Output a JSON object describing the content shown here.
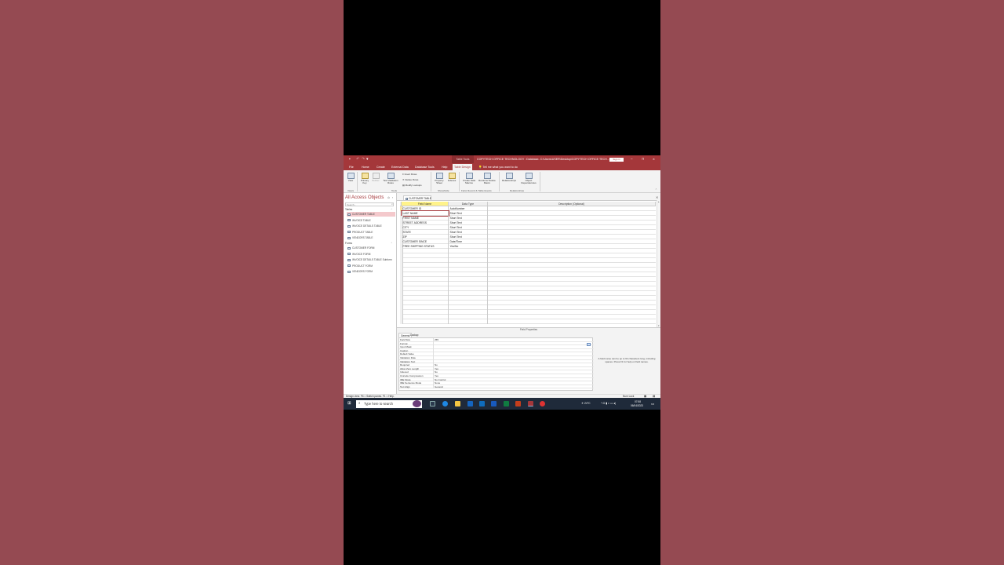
{
  "titlebar": {
    "contextual_tab": "Table Tools",
    "title": "COPYTECH OFFICE TECHNOLOGY : Database- C:\\Users\\USER\\Desktop\\COPYTECH OFFICE TECH...",
    "sign_in": "Sign in",
    "minimize": "–",
    "restore": "❐",
    "close": "✕"
  },
  "menu": {
    "items": [
      "File",
      "Home",
      "Create",
      "External Data",
      "Database Tools",
      "Help",
      "Table Design"
    ],
    "tell_me": "Tell me what you want to do"
  },
  "ribbon": {
    "view": "View",
    "primary_key": "Primary Key",
    "builder": "Builder",
    "test_validation": "Test Validation Rules",
    "insert_rows": "Insert Rows",
    "delete_rows": "Delete Rows",
    "modify_lookups": "Modify Lookups",
    "property_sheet": "Property Sheet",
    "indexes": "Indexes",
    "create_data_macros": "Create Data Macros",
    "rename_delete_macro": "Rename/ Delete Macro",
    "relationships": "Relationships",
    "object_dependencies": "Object Dependencies",
    "groups": [
      "Views",
      "Tools",
      "Show/Hide",
      "Field, Record & Table Events",
      "Relationships"
    ]
  },
  "nav": {
    "title": "All Access Objects",
    "search_placeholder": "Search...",
    "tables_label": "Tables",
    "tables": [
      "CUSTOMER TABLE",
      "INVOICE TABLE",
      "INVOICE DETAILS TABLE",
      "PRODUCT TABLE",
      "VENDORS TABLE"
    ],
    "forms_label": "Forms",
    "forms": [
      "CUSTOMER FORM",
      "INVOICE FORM",
      "INVOICE DETAILS TABLE Subform",
      "PRODUCT FORM",
      "VENDORS FORM"
    ]
  },
  "doc_tab": "CUSTOMER TABLE",
  "grid": {
    "headers": [
      "Field Name",
      "Data Type",
      "Description (Optional)"
    ],
    "rows": [
      {
        "name": "CUSTOMER ID",
        "type": "AutoNumber"
      },
      {
        "name": "LAST NAME",
        "type": "Short Text"
      },
      {
        "name": "FIRST NAME",
        "type": "Short Text"
      },
      {
        "name": "STREET ADDRESS",
        "type": "Short Text"
      },
      {
        "name": "CITY",
        "type": "Short Text"
      },
      {
        "name": "STATE",
        "type": "Short Text"
      },
      {
        "name": "ZIP",
        "type": "Short Text"
      },
      {
        "name": "CUSTOMER SINCE",
        "type": "Date/Time"
      },
      {
        "name": "FREE SHIPPING STATUS",
        "type": "Yes/No"
      }
    ]
  },
  "field_properties": {
    "title": "Field Properties",
    "tabs": [
      "General",
      "Lookup"
    ],
    "rows": [
      {
        "label": "Field Size",
        "value": "255"
      },
      {
        "label": "Format",
        "value": ""
      },
      {
        "label": "Input Mask",
        "value": ""
      },
      {
        "label": "Caption",
        "value": ""
      },
      {
        "label": "Default Value",
        "value": ""
      },
      {
        "label": "Validation Rule",
        "value": ""
      },
      {
        "label": "Validation Text",
        "value": ""
      },
      {
        "label": "Required",
        "value": "No"
      },
      {
        "label": "Allow Zero Length",
        "value": "Yes"
      },
      {
        "label": "Indexed",
        "value": "No"
      },
      {
        "label": "Unicode Compression",
        "value": "Yes"
      },
      {
        "label": "IME Mode",
        "value": "No Control"
      },
      {
        "label": "IME Sentence Mode",
        "value": "None"
      },
      {
        "label": "Text Align",
        "value": "General"
      }
    ],
    "help": "A field name can be up to 64 characters long, including spaces. Press F1 for help on field names."
  },
  "status": {
    "left": "Design view. F6 = Switch panes. F1 = Help.",
    "num_lock": "Num Lock"
  },
  "taskbar": {
    "search_placeholder": "Type here to search",
    "weather": "24°C",
    "time": "07:58",
    "date": "06/04/2023"
  }
}
